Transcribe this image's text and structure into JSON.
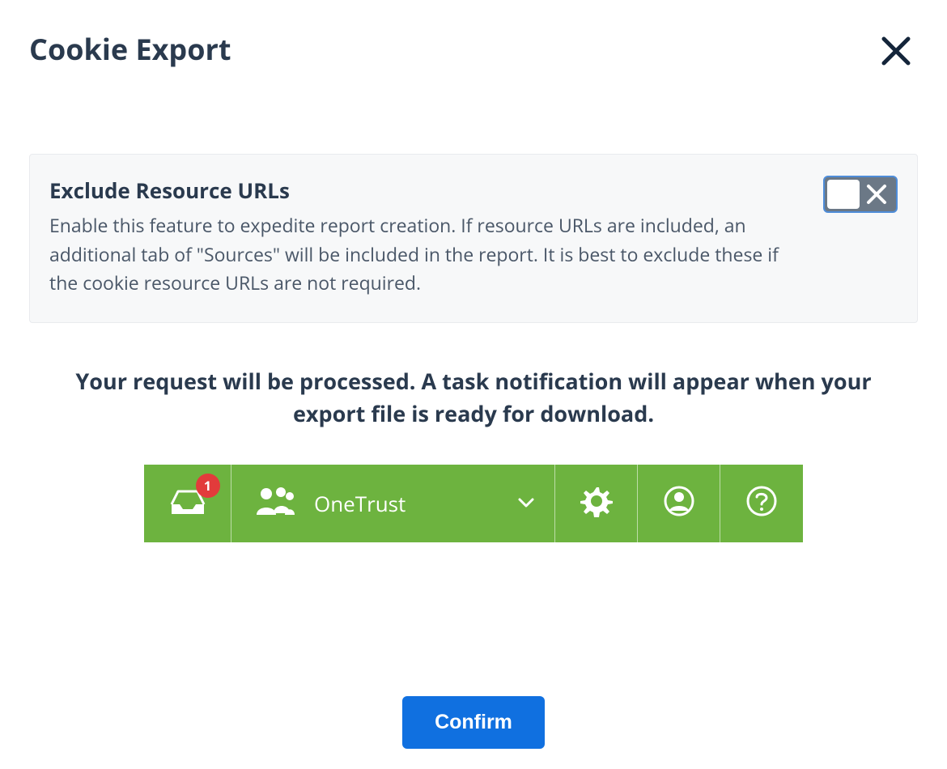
{
  "modal": {
    "title": "Cookie Export"
  },
  "option": {
    "title": "Exclude Resource URLs",
    "description": "Enable this feature to expedite report creation. If resource URLs are included, an additional tab of \"Sources\" will be included in the report. It is best to exclude these if the cookie resource URLs are not required.",
    "toggle_state": "off"
  },
  "status_message": "Your request will be processed. A task notification will appear when your export file is ready for download.",
  "toolbar": {
    "notification_count": "1",
    "org_label": "OneTrust"
  },
  "buttons": {
    "confirm": "Confirm"
  },
  "colors": {
    "primary_blue": "#1070e0",
    "toolbar_green": "#6db33f",
    "badge_red": "#e23b3b"
  }
}
